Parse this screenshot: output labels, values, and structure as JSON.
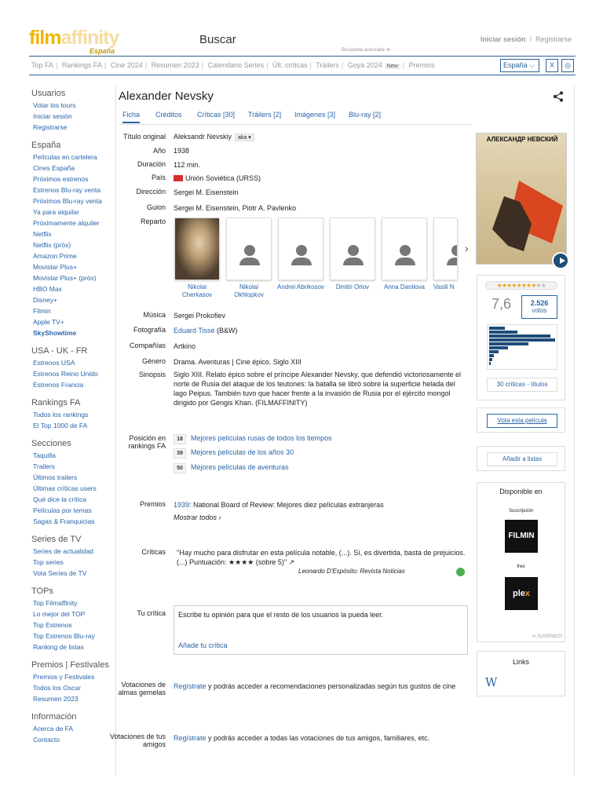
{
  "header": {
    "logo_film": "film",
    "logo_affinity": "affinity",
    "logo_country": "España",
    "search_label": "Buscar",
    "advanced_search": "Búsqueda avanzada ≫",
    "login": "Iniciar sesión",
    "register": "Registrarse"
  },
  "nav": {
    "items": [
      "Top FA",
      "Rankings FA",
      "Cine 2024",
      "Resumen 2023",
      "Calendario Series",
      "Últ. críticas",
      "Tráilers",
      "Goya 2024",
      "Premios"
    ],
    "new_badge": "New",
    "country": "España ⌵",
    "x_icon": "X",
    "ig_icon": "◎"
  },
  "sidebar": {
    "sections": [
      {
        "title": "Usuarios",
        "items": [
          "Votar los tours",
          "Iniciar sesión",
          "Registrarse"
        ]
      },
      {
        "title": "España",
        "items": [
          "Películas en cartelera",
          "Cines España",
          "Próximos estrenos",
          "Estrenos Blu-ray venta",
          "Próximos Blu-ray venta",
          "Ya para alquilar",
          "Próximamente alquiler",
          "Netflix",
          "Netflix (próx)",
          "Amazon Prime",
          "Movistar Plus+",
          "Movistar Plus+ (próx)",
          "HBO Max",
          "Disney+",
          "Filmin",
          "Apple TV+",
          "SkyShowtime"
        ]
      },
      {
        "title": "USA - UK - FR",
        "items": [
          "Estrenos USA",
          "Estrenos Reino Unido",
          "Estrenos Francia"
        ]
      },
      {
        "title": "Rankings FA",
        "items": [
          "Todos los rankings",
          "El Top 1000 de FA"
        ]
      },
      {
        "title": "Secciones",
        "items": [
          "Taquilla",
          "Trailers",
          "Últimos trailers",
          "Últimas críticas users",
          "Qué dice la crítica",
          "Películas por temas",
          "Sagas & Franquicias"
        ]
      },
      {
        "title": "Series de TV",
        "items": [
          "Series de actualidad",
          "Top series",
          "Vota Series de TV"
        ]
      },
      {
        "title": "TOPs",
        "items": [
          "Top Filmaffinity",
          "Lo mejor del TOP",
          "Top Estrenos",
          "Top Estrenos Blu-ray",
          "Ranking de listas"
        ]
      },
      {
        "title": "Premios | Festivales",
        "items": [
          "Premios y Festivales",
          "Todos los Oscar",
          "Resumen 2023"
        ]
      },
      {
        "title": "Información",
        "items": [
          "Acerca de FA",
          "Contacto"
        ]
      }
    ]
  },
  "movie": {
    "title": "Alexander Nevsky",
    "tabs": [
      "Ficha",
      "Créditos",
      "Críticas [30]",
      "Tráilers [2]",
      "Imágenes [3]",
      "Blu-ray [2]"
    ],
    "labels": {
      "original_title": "Título original",
      "year": "Año",
      "duration": "Duración",
      "country": "País",
      "direction": "Dirección",
      "script": "Guion",
      "cast": "Reparto",
      "music": "Música",
      "photography": "Fotografía",
      "companies": "Compañías",
      "genre": "Género",
      "synopsis": "Sinopsis",
      "rank_position": "Posición en rankings FA",
      "awards": "Premios",
      "critics": "Críticas",
      "your_critic": "Tu crítica",
      "soulmates": "Votaciones de almas gemelas",
      "friends": "Votaciones de tus amigos"
    },
    "original_title": "Aleksandr Nevskiy",
    "aka": "aka ▾",
    "year": "1938",
    "duration": "112 min.",
    "country": "Unión Soviética (URSS)",
    "direction": "Sergei M. Eisenstein",
    "script": "Sergei M. Eisenstein, Piotr A. Pavlenko",
    "cast": [
      "Nikolai Cherkasov",
      "Nikolai Okhlopkov",
      "Andrei Abrikosov",
      "Dmitri Orlov",
      "Anna Danilova",
      "Vasili N"
    ],
    "cast_next": "›",
    "music": "Sergei Prokofiev",
    "photography": "Eduard Tissé",
    "photography_note": "(B&W)",
    "companies": "Artkino",
    "genre": "Drama. Aventuras | Cine épico. Siglo XIII",
    "synopsis": "Siglo XIII. Relato épico sobre el príncipe Alexander Nevsky, que defendió victoriosamente el norte de Rusia del ataque de los teutones: la batalla se libró sobre la superficie helada del lago Peipus. También tuvo que hacer frente a la invasión de Rusia por el ejército mongol dirigido por Gengis Khan. (FILMAFFINITY)",
    "rankings": [
      {
        "num": "18",
        "text": "Mejores películas rusas de todos los tiempos"
      },
      {
        "num": "39",
        "text": "Mejores películas de los años 30"
      },
      {
        "num": "50",
        "text": "Mejores películas de aventuras"
      }
    ],
    "award_year": "1939",
    "award_text": ": National Board of Review: Mejores diez películas extranjeras",
    "show_all": "Mostrar todos ›",
    "quote": "\"Hay mucho para disfrutar en esta película notable, (...). Sí, es divertida, basta de prejuicios. (...) Puntuación: ★★★★ (sobre 5)\" ↗",
    "quote_author": "Leonardo D'Espósito: Revista Noticias",
    "review_placeholder": "Escribe tu opinión para que el resto de los usuarios la pueda leer.",
    "review_link": "Añade tu crítica",
    "register_link": "Regístrate",
    "soulmates_text": " y podrás acceder a recomendaciones personalizadas según tus gustos de cine",
    "friends_text": " y podrás acceder a todas las votaciones de tus amigos, familiares, etc."
  },
  "right": {
    "poster_title": "АЛЕКСАНДР НЕВСКИЙ",
    "stars_filled": "★★★★★★★★",
    "stars_empty": "★★",
    "rating": "7,6",
    "votes": "2.526",
    "votes_label": "votos",
    "critics_link": "30 críticas - títulos",
    "vote_button": "Vota esta película",
    "list_button": "Añadir a listas",
    "available": "Disponible en",
    "subscription": "Suscripción",
    "filmin": "FILMIN",
    "free": "free",
    "plex_a": "ple",
    "plex_b": "x",
    "justwatch": "⊳JustWatch",
    "links_title": "Links",
    "wiki": "W"
  }
}
